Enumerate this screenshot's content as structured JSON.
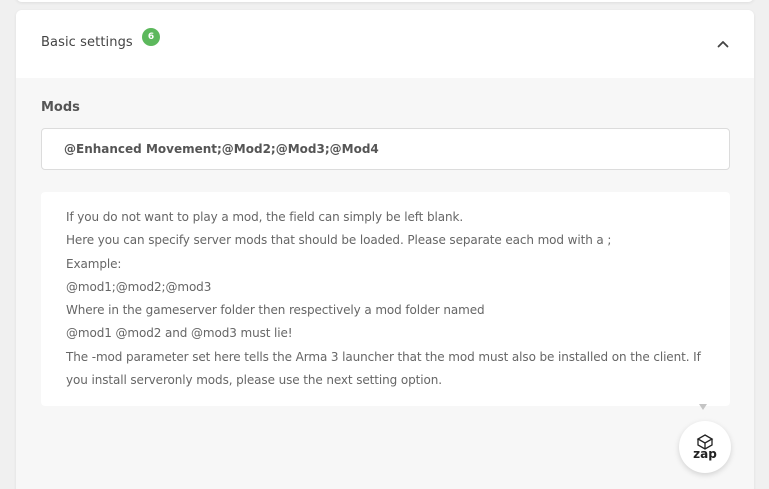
{
  "section": {
    "title": "Basic settings",
    "badge_count": "6",
    "toggle_icon": "chevron-up-icon"
  },
  "mods": {
    "label": "Mods",
    "value": "@Enhanced Movement;@Mod2;@Mod3;@Mod4"
  },
  "help": {
    "lines": [
      "If you do not want to play a mod, the field can simply be left blank.",
      "Here you can specify server mods that should be loaded. Please separate each mod with a ;",
      "Example:",
      "@mod1;@mod2;@mod3",
      "Where in the gameserver folder then respectively a mod folder named",
      "@mod1 @mod2 and @mod3 must lie!",
      "The -mod parameter set here tells the Arma 3 launcher that the mod must also be installed on the client. If",
      "you install serveronly mods, please use the next setting option."
    ]
  },
  "chat_widget": {
    "brand": "zap",
    "icon": "hosting-logo-icon"
  },
  "colors": {
    "badge": "#5cb85c",
    "page_bg": "#f0f0f0",
    "card_bg": "#f7f7f7"
  }
}
